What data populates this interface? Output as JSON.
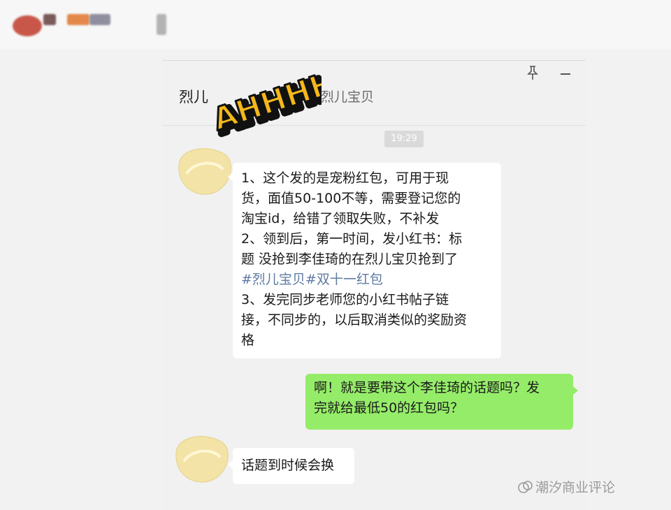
{
  "chat": {
    "title_left": "烈儿",
    "title_right": "@烈儿宝贝",
    "sticker_text": "AHHHH!",
    "timestamp": "19:29",
    "messages": {
      "first": {
        "lines": [
          "1、这个发的是宠粉红包，可用于现",
          "货，面值50-100不等，需要登记您的",
          "淘宝id，给错了领取失败，不补发",
          "2、领到后，第一时间，发小红书：标",
          "题 没抢到李佳琦的在烈儿宝贝抢到了",
          "#烈儿宝贝#双十一红包",
          "3、发完同步老师您的小红书帖子链",
          "接，不同步的，以后取消类似的奖励资",
          "格"
        ]
      },
      "reply": {
        "lines": [
          "啊！就是要带这个李佳琦的话题吗？发",
          "完就给最低50的红包吗？"
        ]
      },
      "last": {
        "text": "话题到时候会换"
      }
    }
  },
  "watermark": {
    "text": "潮汐商业评论"
  },
  "colors": {
    "bubble_green": "#95ec69",
    "hashtag": "#5f7ba3",
    "avatar_fill": "#f3e3a6"
  }
}
